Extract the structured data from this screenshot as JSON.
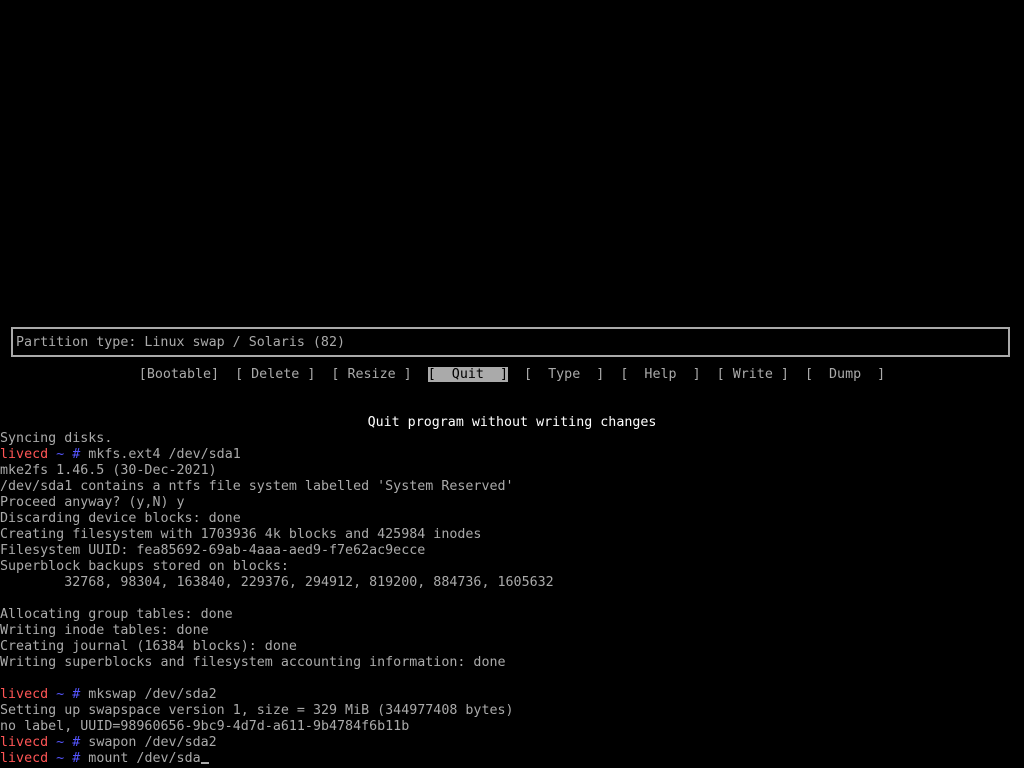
{
  "cfdisk": {
    "partition_type": "Partition type: Linux swap / Solaris (82)",
    "menu": [
      {
        "label": "[Bootable]",
        "selected": false
      },
      {
        "label": "[ Delete ]",
        "selected": false
      },
      {
        "label": "[ Resize ]",
        "selected": false
      },
      {
        "label": "[  Quit  ]",
        "selected": true
      },
      {
        "label": "[  Type  ]",
        "selected": false
      },
      {
        "label": "[  Help  ]",
        "selected": false
      },
      {
        "label": "[ Write ]",
        "selected": false
      },
      {
        "label": "[  Dump  ]",
        "selected": false
      }
    ],
    "hint": "Quit program without writing changes"
  },
  "prompt": {
    "host": "livecd",
    "cwd": "~",
    "symbol": "#"
  },
  "terminal": {
    "lines": [
      {
        "type": "output",
        "text": "Syncing disks."
      },
      {
        "type": "prompt",
        "command": "mkfs.ext4 /dev/sda1"
      },
      {
        "type": "output",
        "text": "mke2fs 1.46.5 (30-Dec-2021)"
      },
      {
        "type": "output",
        "text": "/dev/sda1 contains a ntfs file system labelled 'System Reserved'"
      },
      {
        "type": "output",
        "text": "Proceed anyway? (y,N) y"
      },
      {
        "type": "output",
        "text": "Discarding device blocks: done"
      },
      {
        "type": "output",
        "text": "Creating filesystem with 1703936 4k blocks and 425984 inodes"
      },
      {
        "type": "output",
        "text": "Filesystem UUID: fea85692-69ab-4aaa-aed9-f7e62ac9ecce"
      },
      {
        "type": "output",
        "text": "Superblock backups stored on blocks:"
      },
      {
        "type": "output",
        "text": "        32768, 98304, 163840, 229376, 294912, 819200, 884736, 1605632"
      },
      {
        "type": "output",
        "text": ""
      },
      {
        "type": "output",
        "text": "Allocating group tables: done"
      },
      {
        "type": "output",
        "text": "Writing inode tables: done"
      },
      {
        "type": "output",
        "text": "Creating journal (16384 blocks): done"
      },
      {
        "type": "output",
        "text": "Writing superblocks and filesystem accounting information: done"
      },
      {
        "type": "output",
        "text": ""
      },
      {
        "type": "prompt",
        "command": "mkswap /dev/sda2"
      },
      {
        "type": "output",
        "text": "Setting up swapspace version 1, size = 329 MiB (344977408 bytes)"
      },
      {
        "type": "output",
        "text": "no label, UUID=98960656-9bc9-4d7d-a611-9b4784f6b11b"
      },
      {
        "type": "prompt",
        "command": "swapon /dev/sda2"
      },
      {
        "type": "prompt",
        "command": "mount /dev/sda",
        "cursor": true
      }
    ]
  },
  "colors": {
    "background": "#000000",
    "text": "#aaaaaa",
    "bright_text": "#ffffff",
    "prompt_host": "#ff5555",
    "prompt_tilde": "#5555ff"
  }
}
